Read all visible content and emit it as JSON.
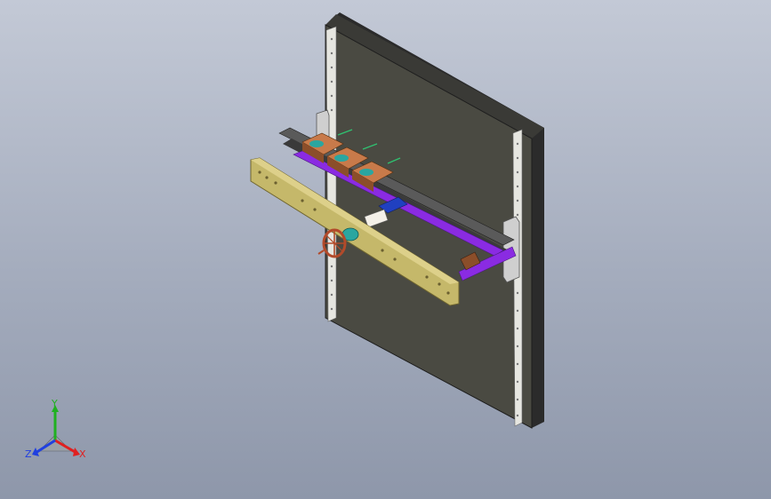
{
  "viewport": {
    "background_top": "#c3c9d6",
    "background_bottom": "#8e97aa"
  },
  "triad": {
    "x_label": "X",
    "y_label": "Y",
    "z_label": "Z",
    "x_color": "#e02020",
    "y_color": "#20b020",
    "z_color": "#2040e0"
  },
  "colors": {
    "wall_face": "#4a4a42",
    "wall_side": "#2e2e2e",
    "column": "#d9d9d4",
    "plate": "#c5b86a",
    "plate_edge": "#8d8040",
    "purple_frame": "#8a2be2",
    "rail": "#3c3c3c",
    "motor": "#c87a4a",
    "teal_part": "#2aa6a0",
    "handwheel": "#b24a2a"
  }
}
